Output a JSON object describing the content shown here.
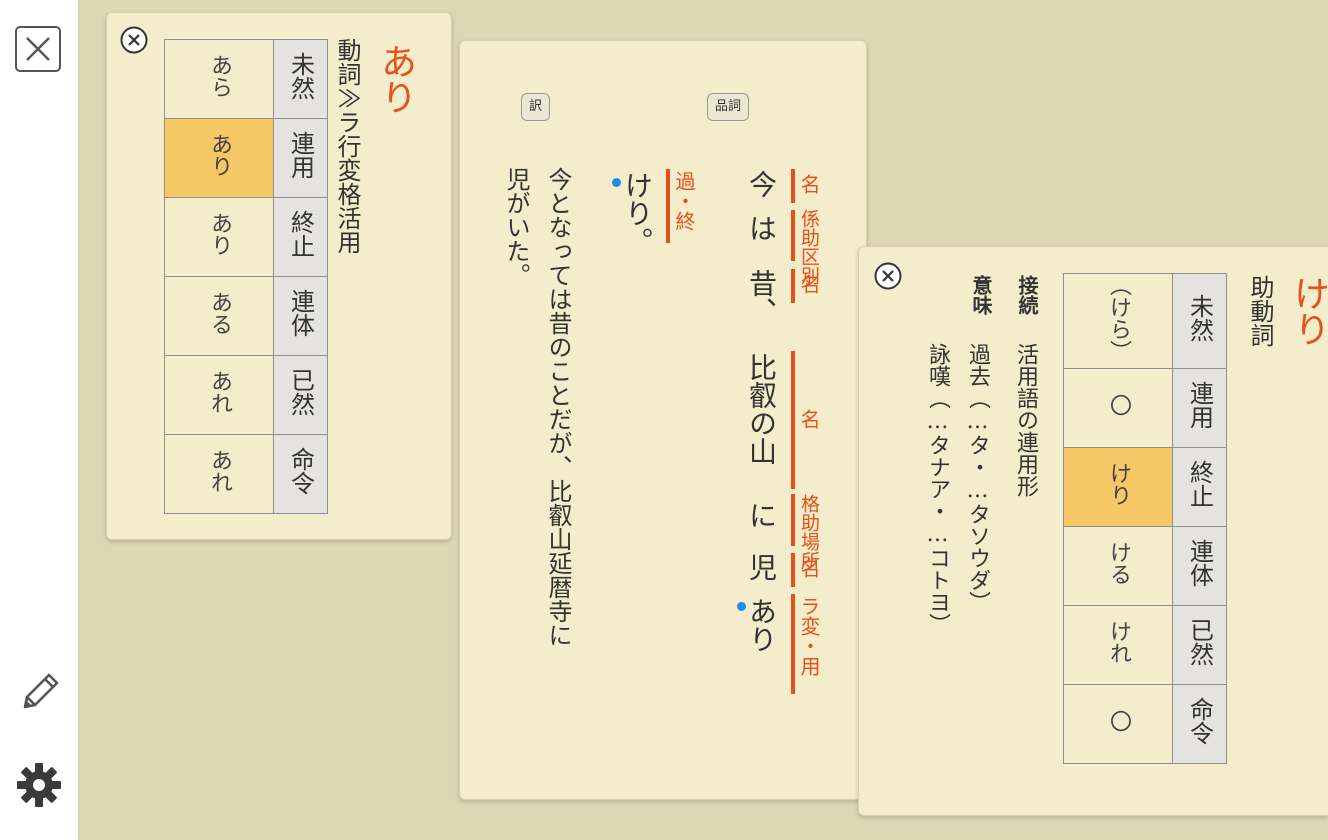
{
  "sidebar": {
    "close_icon": "close-x-icon",
    "pencil_icon": "pencil-icon",
    "settings_icon": "gear-icon"
  },
  "ari_card": {
    "title": "あり",
    "pos": "動詞≫ラ行変格活用",
    "rows": [
      {
        "label": "未然",
        "value": "あら",
        "highlight": false
      },
      {
        "label": "連用",
        "value": "あり",
        "highlight": true
      },
      {
        "label": "終止",
        "value": "あり",
        "highlight": false
      },
      {
        "label": "連体",
        "value": "ある",
        "highlight": false
      },
      {
        "label": "已然",
        "value": "あれ",
        "highlight": false
      },
      {
        "label": "命令",
        "value": "あれ",
        "highlight": false
      }
    ]
  },
  "main_card": {
    "tag_translation": "訳",
    "tag_pos": "品詞",
    "col1": {
      "chunks": [
        "今",
        "は",
        "昔、",
        "比叡の山",
        "に",
        "児",
        "あり"
      ],
      "labels": [
        "名",
        "係助区別",
        "名",
        "名",
        "格助場所",
        "名",
        "ラ変・用"
      ]
    },
    "col2": {
      "text": "けり。",
      "label": "過・終"
    },
    "translation": [
      "今となっては昔のことだが、比叡山延暦寺に",
      "児がいた。"
    ]
  },
  "keri_card": {
    "title": "けり",
    "pos": "助動詞",
    "connection_label": "接続",
    "connection_text": "活用語の連用形",
    "meaning_label": "意味",
    "meanings": [
      "過去（…タ・…タソウダ）",
      "詠嘆（…タナア・…コトヨ）"
    ],
    "rows": [
      {
        "label": "未然",
        "value": "（けら）",
        "highlight": false
      },
      {
        "label": "連用",
        "value": "〇",
        "highlight": false
      },
      {
        "label": "終止",
        "value": "けり",
        "highlight": true
      },
      {
        "label": "連体",
        "value": "ける",
        "highlight": false
      },
      {
        "label": "已然",
        "value": "けれ",
        "highlight": false
      },
      {
        "label": "命令",
        "value": "〇",
        "highlight": false
      }
    ]
  },
  "colors": {
    "accent_orange": "#e8501a",
    "highlight_yellow": "#f6c765",
    "card_bg": "#f4edcb",
    "desk_bg": "#ddd8b4",
    "dot_blue": "#1a8df0"
  }
}
